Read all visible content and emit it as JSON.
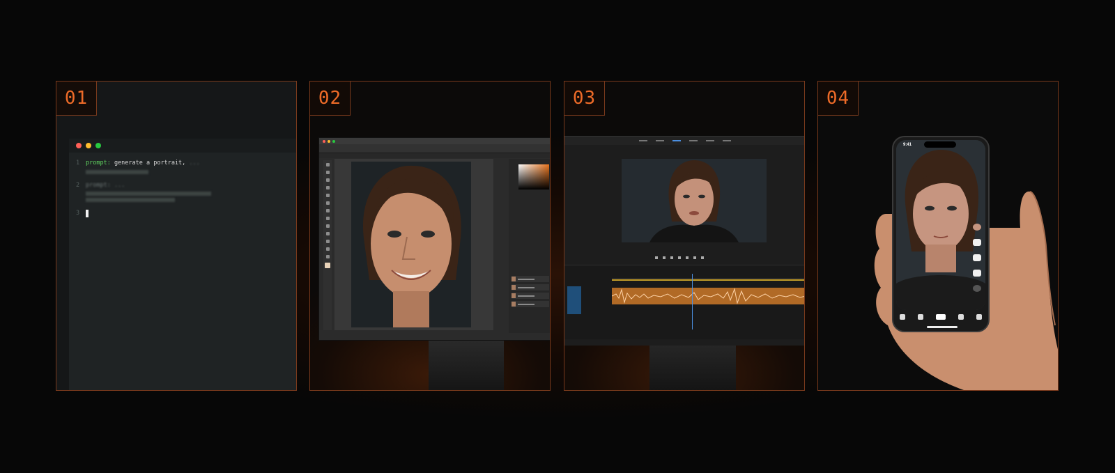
{
  "panels": [
    {
      "number": "01"
    },
    {
      "number": "02"
    },
    {
      "number": "03"
    },
    {
      "number": "04"
    }
  ],
  "editor": {
    "lines": [
      {
        "n": "1",
        "keyword": "prompt:",
        "text": " generate a portrait,",
        "faded": " ..."
      },
      {
        "n": "2",
        "keyword": "prompt:",
        "text": "",
        "faded": " ..."
      },
      {
        "n": "3",
        "keyword": "",
        "text": "",
        "faded": ""
      }
    ]
  },
  "phone": {
    "time": "9:41"
  },
  "colors": {
    "accent": "#ee6b28",
    "border": "#7a3a1c",
    "waveform": "#e28a3a",
    "code_keyword": "#5fd15f"
  }
}
